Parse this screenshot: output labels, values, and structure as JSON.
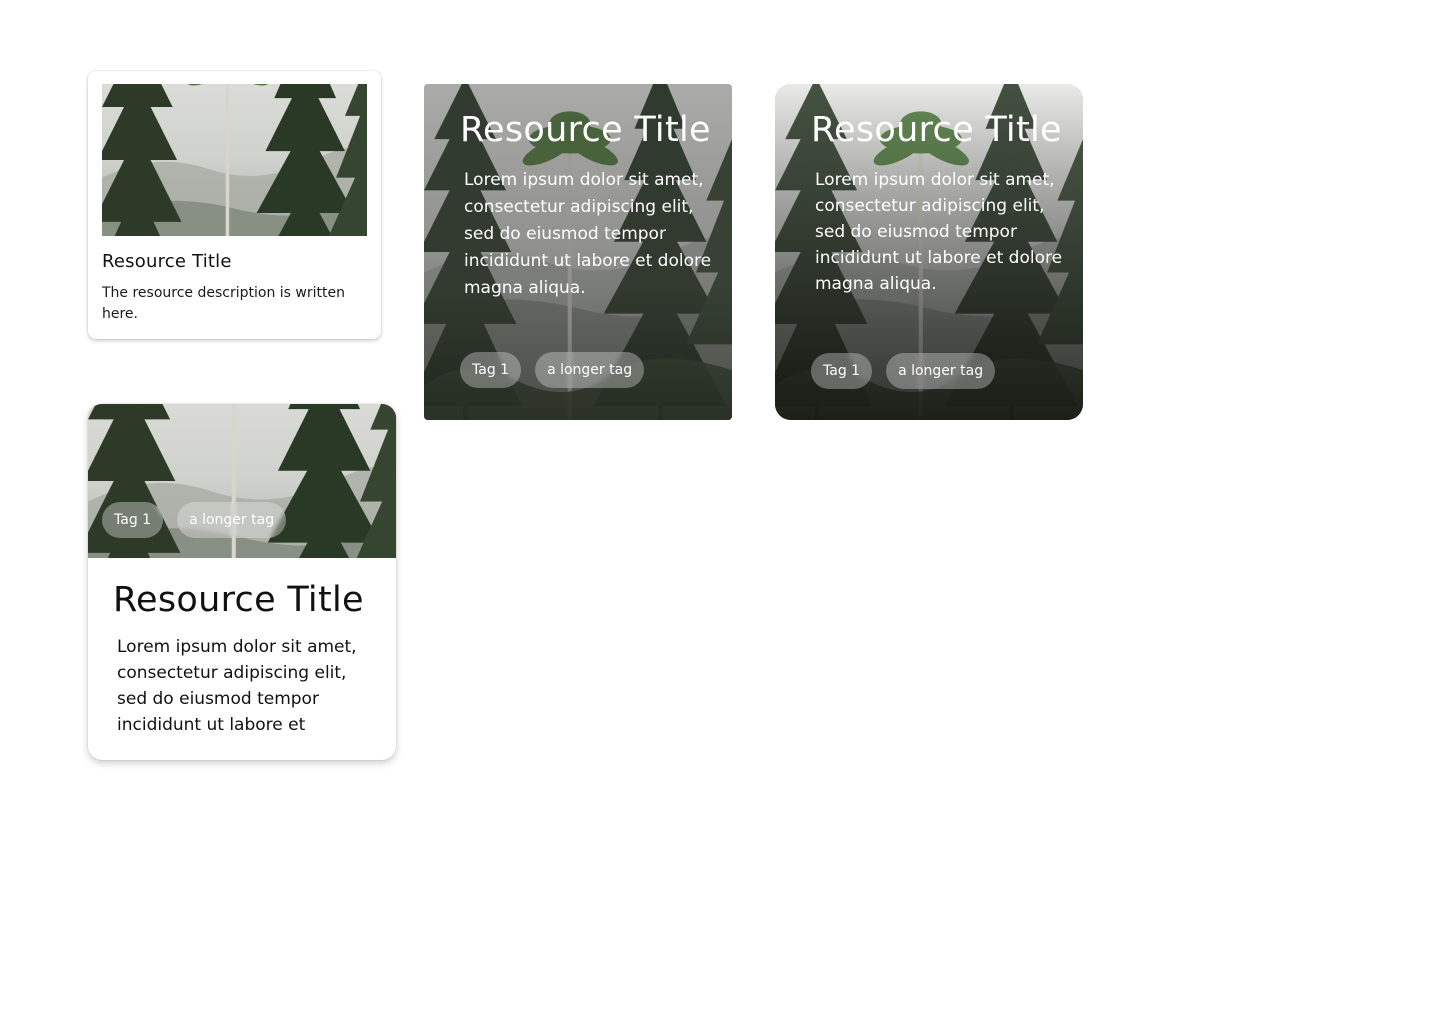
{
  "cards": {
    "small": {
      "title": "Resource Title",
      "description": "The resource description is written here."
    },
    "overlay_square": {
      "title": "Resource Title",
      "description": "Lorem ipsum dolor sit amet, consectetur adipiscing elit, sed do eiusmod tempor incididunt ut labore et dolore magna aliqua.",
      "tags": [
        "Tag 1",
        "a longer tag"
      ]
    },
    "overlay_rounded": {
      "title": "Resource Title",
      "description": "Lorem ipsum dolor sit amet, consectetur adipiscing elit, sed do eiusmod tempor incididunt ut labore et dolore magna aliqua.",
      "tags": [
        "Tag 1",
        "a longer tag"
      ]
    },
    "image_top": {
      "title": "Resource Title",
      "description": "Lorem ipsum dolor sit amet, consectetur adipiscing elit, sed do eiusmod tempor incididunt ut labore et",
      "tags": [
        "Tag 1",
        "a longer tag"
      ]
    }
  },
  "colors": {
    "background": "#ffffff",
    "card": "#ffffff",
    "text": "#111111",
    "overlay_text": "#ffffff"
  },
  "icons": {
    "card_image": "forest-photo"
  }
}
